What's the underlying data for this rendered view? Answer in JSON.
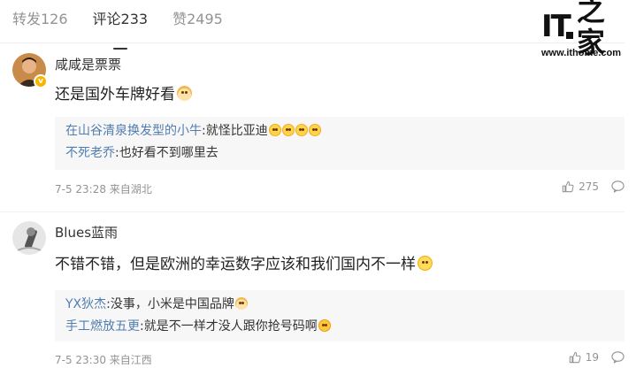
{
  "tabs": [
    {
      "label": "转发126"
    },
    {
      "label": "评论233"
    },
    {
      "label": "赞2495"
    }
  ],
  "logo": {
    "text": "IT",
    "text_zh": "之家",
    "url": "www.ithome.com"
  },
  "comments": [
    {
      "username": "咸咸是票票",
      "content": "还是国外车牌好看",
      "replies": [
        {
          "name": "在山谷清泉换发型的小牛",
          "text": ":就怪比亚迪"
        },
        {
          "name": "不死老乔",
          "text": ":也好看不到哪里去"
        }
      ],
      "meta": "7-5 23:28 来自湖北",
      "likes": "275"
    },
    {
      "username": "Blues蓝雨",
      "content": "不错不错，但是欧洲的幸运数字应该和我们国内不一样",
      "replies": [
        {
          "name": "YX狄杰",
          "text": ":没事，小米是中国品牌"
        },
        {
          "name": "手工燃放五更",
          "text": ":就是不一样才没人跟你抢号码啊"
        }
      ],
      "meta": "7-5 23:30 来自江西",
      "likes": "19"
    }
  ],
  "colors": {
    "link": "#507daf",
    "muted": "#939393",
    "reply_bg": "#f7f7f7",
    "verified": "#f7b500"
  }
}
